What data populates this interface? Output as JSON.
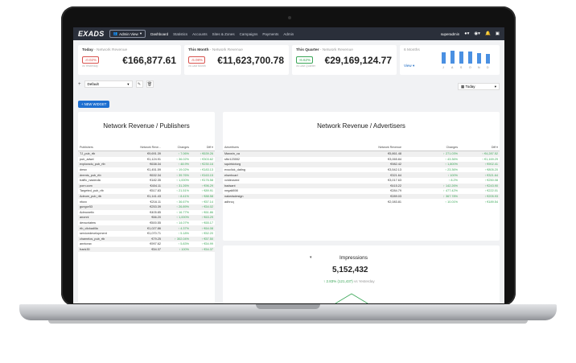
{
  "app": {
    "logo": "EXADS",
    "admin_view": "Admin View"
  },
  "nav": [
    "Dashboard",
    "Statistics",
    "Accounts",
    "Sites & Zones",
    "Campaigns",
    "Payments",
    "Admin"
  ],
  "user": {
    "name": "superadmin"
  },
  "cards": {
    "today": {
      "title": "Today",
      "subtitle": "- Network Revenue",
      "change": "0.02%",
      "value": "€166,877.61",
      "note": "vs Yesterday"
    },
    "month": {
      "title": "This Month",
      "subtitle": "- Network Revenue",
      "change": "5.08%",
      "value": "€11,623,700.78",
      "note": "vs Last Month"
    },
    "quarter": {
      "title": "This Quarter",
      "subtitle": "- Network Revenue",
      "change": "6.62%",
      "value": "€29,169,124.77",
      "note": "vs Last Quarter"
    },
    "six": {
      "title": "6 Months",
      "view": "View"
    }
  },
  "mini_chart": {
    "labels": [
      "J",
      "A",
      "S",
      "O",
      "N",
      "D"
    ],
    "values": [
      0.72,
      0.84,
      0.8,
      0.78,
      0.68,
      0.62
    ]
  },
  "controls": {
    "default": "Default",
    "today": "Today",
    "new_widget": "+ NEW WIDGET"
  },
  "publishers": {
    "title": "Network Revenue / Publishers",
    "headers": [
      "Publishers",
      "Network Reve...",
      "Changes",
      "Diff"
    ],
    "rows": [
      [
        "TJ_pub_rtb",
        "€9,691.39",
        "7.06%",
        "€639.26"
      ],
      [
        "pub_adwd",
        "€1,124.91",
        "36.02%",
        "€303.62"
      ],
      [
        "exploradu_pub_rtb",
        "€638.34",
        "48.9%",
        "€230.16"
      ],
      [
        "dmsv",
        "€1,451.59",
        "19.02%",
        "€183.13"
      ],
      [
        "dremts_pub_rtb",
        "€632.34",
        "39.76%",
        "€163.15"
      ],
      [
        "traffic_nasteolic",
        "€182.35",
        "1,000%",
        "€176.58"
      ],
      [
        "porn.com",
        "€404.11",
        "31.26%",
        "€96.29"
      ],
      [
        "Targeted_pub_rtb",
        "€517.83",
        "21.51%",
        "€89.91"
      ],
      [
        "Adeum_pub_rtb",
        "€1,141.43",
        "8.41%",
        "€88.58"
      ],
      [
        "nfoxx",
        "€216.11",
        "36.67%",
        "€57.14"
      ],
      [
        "gungor53",
        "€253.39",
        "26.89%",
        "€54.02"
      ],
      [
        "Admonetix",
        "€405.85",
        "16.77%",
        "€61.86"
      ],
      [
        "anonni",
        "€66.20",
        "1,000%",
        "€63.29"
      ],
      [
        "devscriatew",
        "€500.55",
        "14.07%",
        "€65.17"
      ],
      [
        "rtb_clickadilla",
        "€1,027.86",
        "4.37%",
        "€64.08"
      ],
      [
        "servicedevelopment",
        "€1,070.71",
        "5.18%",
        "€52.20"
      ],
      [
        "chamelos_pub_rtb",
        "€79.25",
        "302.04%",
        "€57.50"
      ],
      [
        "anntorax",
        "€997.62",
        "5.83%",
        "€54.99"
      ],
      [
        "frank30",
        "€54.37",
        "100%",
        "€54.37"
      ]
    ]
  },
  "advertisers": {
    "title": "Network Revenue / Advertisers",
    "headers": [
      "Advertisers",
      "Network Revenue",
      "Changes",
      "Diff"
    ],
    "rows": [
      [
        "Maxwin_ca",
        "€5,861.48",
        "271.03%",
        "€4,287.52"
      ],
      [
        "sfbr123552",
        "€3,065.84",
        "43.36%",
        "€1,169.29"
      ],
      [
        "squirtdotorg",
        "€982.42",
        "1,800%",
        "€902.41"
      ],
      [
        "exoclick_dating",
        "€3,542.13",
        "23.36%",
        "€805.20"
      ],
      [
        "elserbcart",
        "€321.64",
        "100%",
        "€321.64"
      ],
      [
        "xvideosred",
        "€3,017.63",
        "8.2%",
        "€250.08"
      ],
      [
        "badsant",
        "€415.22",
        "142.26%",
        "€243.90"
      ],
      [
        "negalt898",
        "€284.79",
        "477.42%",
        "€222.01"
      ],
      [
        "nakedsdesign",
        "€289.03",
        "367.78%",
        "€205.93"
      ],
      [
        "adhrcq",
        "€2,083.81",
        "10.01%",
        "€189.54"
      ]
    ]
  },
  "impressions": {
    "title": "Impressions",
    "value": "5,152,432",
    "change": "2.83% (121,437)",
    "change_sub": "vs Yesterday"
  }
}
